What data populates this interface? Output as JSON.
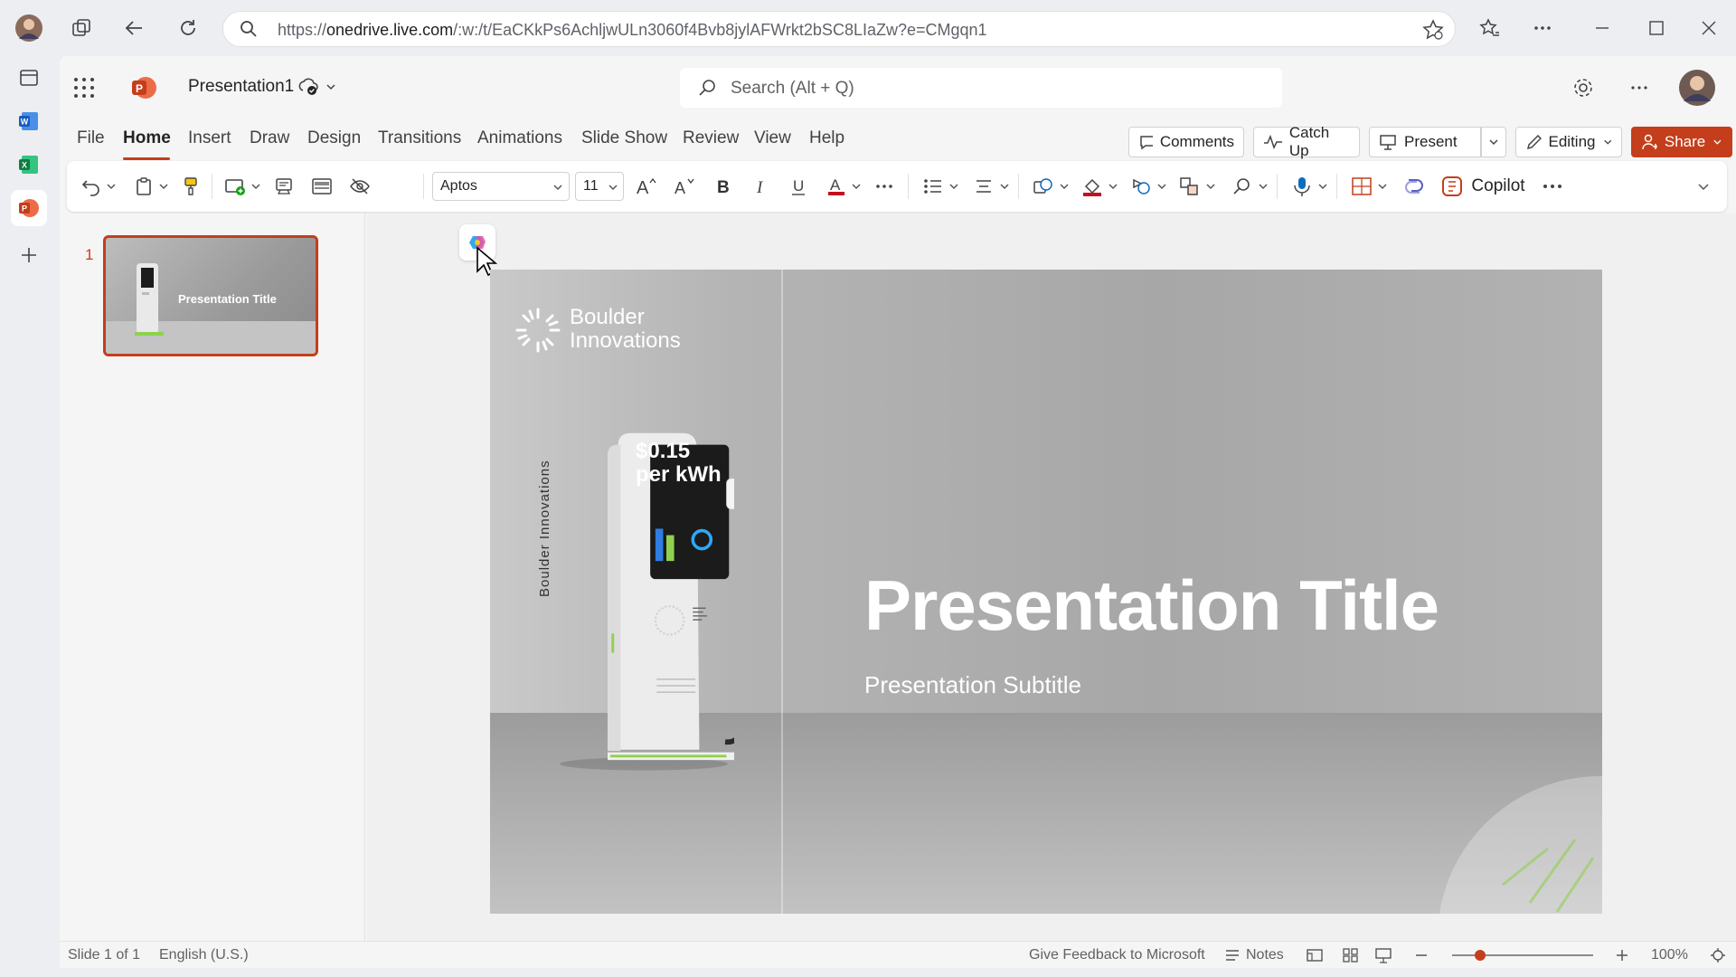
{
  "browser": {
    "url_prefix": "https://",
    "url_domain": "onedrive.live.com",
    "url_rest": "/:w:/t/EaCKkPs6AchljwULn3060f4Bvb8jylAFWrkt2bSC8LIaZw?e=CMgqn1"
  },
  "app": {
    "doc_title": "Presentation1",
    "search_placeholder": "Search (Alt + Q)"
  },
  "ribbon": {
    "tabs": [
      "File",
      "Home",
      "Insert",
      "Draw",
      "Design",
      "Transitions",
      "Animations",
      "Slide Show",
      "Review",
      "View",
      "Help"
    ],
    "comments_label": "Comments",
    "catchup_label": "Catch Up",
    "present_label": "Present",
    "editing_label": "Editing",
    "share_label": "Share",
    "font_name": "Aptos",
    "font_size": "11",
    "copilot_label": "Copilot"
  },
  "thumbnails": {
    "slide_number": "1",
    "thumb_title": "Presentation Title"
  },
  "slide": {
    "brand_line1": "Boulder",
    "brand_line2": "Innovations",
    "title": "Presentation Title",
    "subtitle": "Presentation Subtitle",
    "price_line1": "$0.15",
    "price_line2": "per kWh",
    "charger_vertical_text": "Boulder Innovations"
  },
  "status": {
    "slide_indicator": "Slide 1 of 1",
    "language": "English (U.S.)",
    "feedback": "Give Feedback to Microsoft",
    "notes_label": "Notes",
    "zoom": "100%",
    "zoom_level_fraction": 0.2
  },
  "colors": {
    "accent": "#c43e1c",
    "share_bg": "#c43e1c"
  }
}
